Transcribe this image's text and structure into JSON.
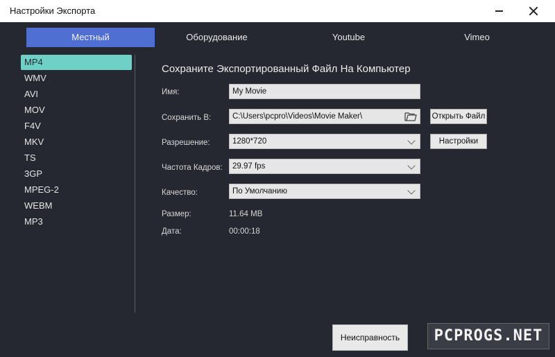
{
  "window": {
    "title": "Настройки Экспорта"
  },
  "tabs": [
    {
      "label": "Местный"
    },
    {
      "label": "Оборудование"
    },
    {
      "label": "Youtube"
    },
    {
      "label": "Vimeo"
    }
  ],
  "formats": [
    "MP4",
    "WMV",
    "AVI",
    "MOV",
    "F4V",
    "MKV",
    "TS",
    "3GP",
    "MPEG-2",
    "WEBM",
    "MP3"
  ],
  "selected_format": "MP4",
  "panel": {
    "heading": "Сохраните Экспортированный Файл На Компьютер",
    "name_label": "Имя:",
    "name_value": "My Movie",
    "save_label": "Сохранить В:",
    "save_path": "C:\\Users\\pcpro\\Videos\\Movie Maker\\",
    "open_file_button": "Открыть Файл",
    "resolution_label": "Разрешение:",
    "resolution_value": "1280*720",
    "settings_button": "Настройки",
    "fps_label": "Частота Кадров:",
    "fps_value": "29.97 fps",
    "quality_label": "Качество:",
    "quality_value": "По Умолчанию",
    "size_label": "Размер:",
    "size_value": "11.64 MB",
    "duration_label": "Дата:",
    "duration_value": "00:00:18"
  },
  "footer": {
    "fault_button": "Неисправность",
    "watermark": "PCPROGS.NET"
  },
  "colors": {
    "background": "#252830",
    "active_tab": "#4f6fd3",
    "selected_item": "#6fd0c8"
  }
}
